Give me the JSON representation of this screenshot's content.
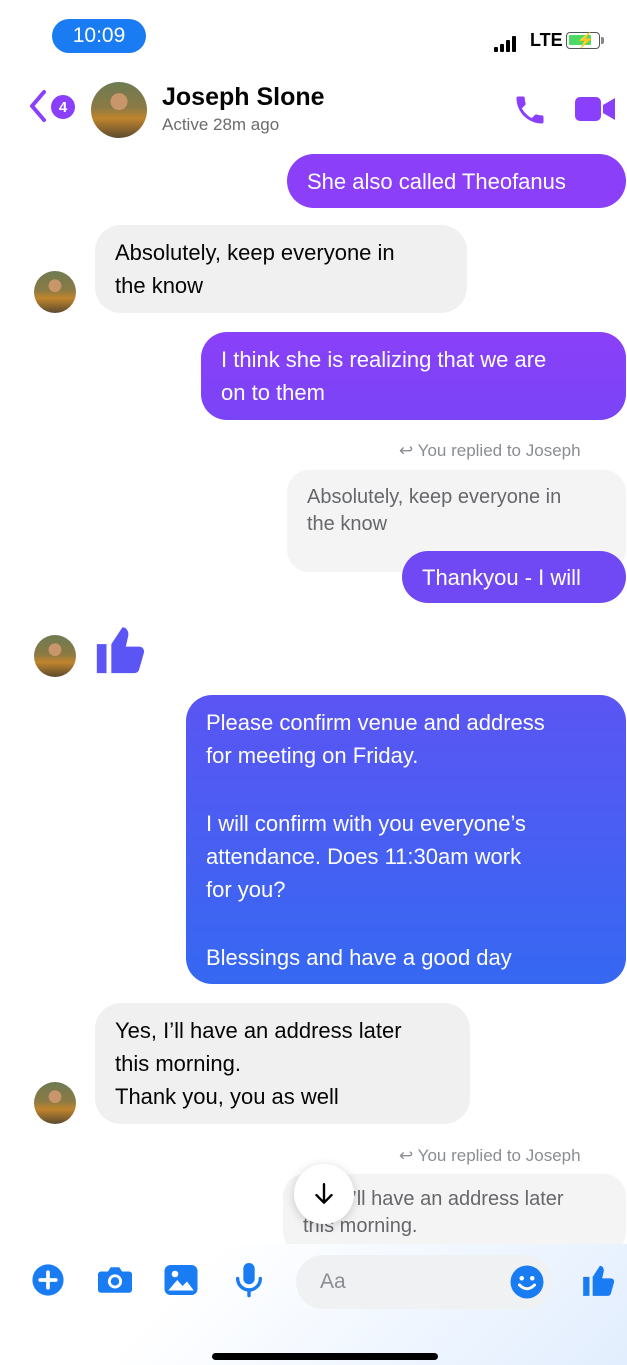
{
  "status_bar": {
    "time": "10:09",
    "network": "LTE"
  },
  "header": {
    "unread_count": "4",
    "contact_name": "Joseph Slone",
    "contact_status": "Active 28m ago"
  },
  "messages": {
    "m1": "She also called Theofanus",
    "m2": [
      "Absolutely, keep everyone in",
      "the know"
    ],
    "m3": [
      "I think she is realizing that we are",
      "on to them"
    ],
    "reply1": {
      "label": "You replied to Joseph",
      "quote": [
        "Absolutely, keep everyone in",
        "the know"
      ]
    },
    "m4": "Thankyou - I will",
    "m5": [
      "Please confirm venue and address",
      "for meeting on Friday.",
      "",
      "I will confirm with you everyone’s",
      "attendance. Does 11:30am work",
      "for you?",
      "",
      "Blessings and have a good day"
    ],
    "m6": [
      "Yes, I’ll have an address later",
      "this morning.",
      "Thank you, you as well"
    ],
    "reply2": {
      "label": "You replied to Joseph",
      "quote": [
        "Yes, I’ll have an address later",
        "this morning."
      ]
    }
  },
  "composer": {
    "placeholder": "Aa"
  },
  "colors": {
    "accent": "#8a3ffc",
    "blue": "#1a7cf2",
    "incoming_bg": "#f0f0f0"
  }
}
